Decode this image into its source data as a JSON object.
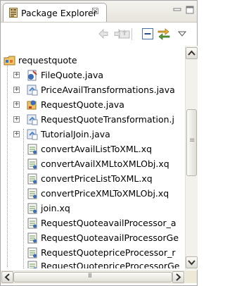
{
  "view": {
    "tab_title": "Package Explorer",
    "tab_close_glyph": "☒"
  },
  "toolbar": {
    "buttons": [
      "back-icon",
      "forward-icon",
      "up-icon",
      "collapse-all-icon",
      "link-with-editor-icon",
      "view-menu-icon"
    ]
  },
  "tree": {
    "project": {
      "label": "requestquote",
      "icon": "project-icon",
      "expanded": true
    },
    "items": [
      {
        "label": "FileQuote.java",
        "icon": "java-file-icon",
        "expandable": true
      },
      {
        "label": "PriceAvailTransformations.java",
        "icon": "transformation-file-icon",
        "expandable": true
      },
      {
        "label": "RequestQuote.java",
        "icon": "process-file-icon",
        "expandable": true
      },
      {
        "label": "RequestQuoteTransformation.j",
        "icon": "transformation-file-icon",
        "expandable": true
      },
      {
        "label": "TutorialJoin.java",
        "icon": "transformation-file-icon",
        "expandable": true
      },
      {
        "label": "convertAvailListToXML.xq",
        "icon": "xquery-file-icon",
        "expandable": false
      },
      {
        "label": "convertAvailXMLtoXMLObj.xq",
        "icon": "xquery-file-icon",
        "expandable": false
      },
      {
        "label": "convertPriceListToXML.xq",
        "icon": "xquery-file-icon",
        "expandable": false
      },
      {
        "label": "convertPriceXMLToXMLObj.xq",
        "icon": "xquery-file-icon",
        "expandable": false
      },
      {
        "label": "join.xq",
        "icon": "xquery-file-icon",
        "expandable": false
      },
      {
        "label": "RequestQuoteavailProcessor_a",
        "icon": "xquery-file-icon",
        "expandable": false
      },
      {
        "label": "RequestQuoteavailProcessorGe",
        "icon": "xquery-file-icon",
        "expandable": false
      },
      {
        "label": "RequestQuotepriceProcessor_r",
        "icon": "xquery-file-icon",
        "expandable": false
      },
      {
        "label": "RequestQuotepriceProcessorGe",
        "icon": "xquery-file-icon",
        "expandable": false
      }
    ]
  },
  "scrollbars": {
    "horizontal_grip": "III",
    "vertical_grip": "≡"
  }
}
